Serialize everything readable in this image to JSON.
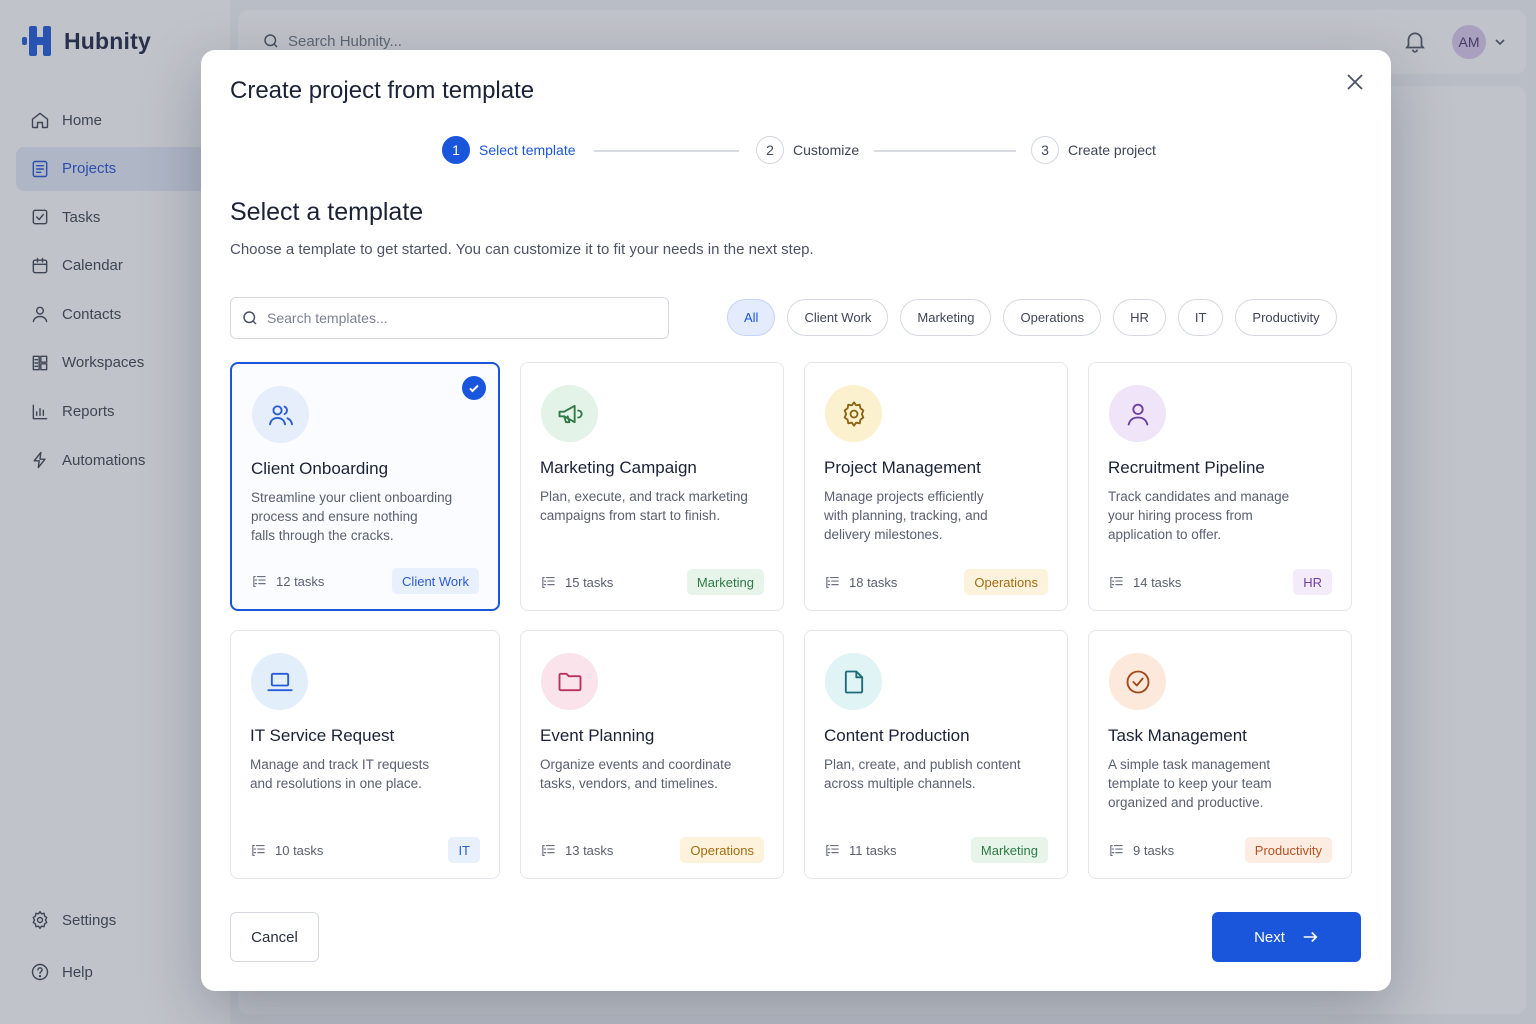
{
  "app": {
    "brand": "Hubnity",
    "search_placeholder": "Search Hubnity...",
    "avatar_initials": "AM",
    "nav": [
      {
        "label": "Home",
        "icon": "home-icon"
      },
      {
        "label": "Projects",
        "icon": "projects-icon",
        "active": true
      },
      {
        "label": "Tasks",
        "icon": "tasks-icon"
      },
      {
        "label": "Calendar",
        "icon": "calendar-icon"
      },
      {
        "label": "Contacts",
        "icon": "contacts-icon"
      },
      {
        "label": "Workspaces",
        "icon": "workspaces-icon"
      },
      {
        "label": "Reports",
        "icon": "reports-icon"
      },
      {
        "label": "Automations",
        "icon": "automations-icon"
      }
    ],
    "nav_bottom": [
      {
        "label": "Settings",
        "icon": "gear-icon"
      },
      {
        "label": "Help",
        "icon": "help-icon"
      }
    ]
  },
  "modal": {
    "title": "Create project from template",
    "steps": [
      {
        "number": "1",
        "label": "Select template",
        "active": true
      },
      {
        "number": "2",
        "label": "Customize"
      },
      {
        "number": "3",
        "label": "Create project"
      }
    ],
    "section_title": "Select a template",
    "section_desc": "Choose a template to get started. You can customize it to fit your needs in the next step.",
    "search_placeholder": "Search templates...",
    "filters": [
      "All",
      "Client Work",
      "Marketing",
      "Operations",
      "HR",
      "IT",
      "Productivity"
    ],
    "active_filter": "All",
    "templates": [
      {
        "title": "Client Onboarding",
        "desc_lines": [
          "Streamline your client onboarding",
          "process and ensure nothing",
          "falls through the cracks."
        ],
        "tasks": "12 tasks",
        "tag": "Client Work",
        "icon": "users-icon",
        "selected": true,
        "icon_bg": "#e6eefc",
        "icon_color": "#2a5bd7",
        "tag_bg": "#e8effd",
        "tag_color": "#2a5bd7"
      },
      {
        "title": "Marketing Campaign",
        "desc_lines": [
          "Plan, execute, and track marketing",
          "campaigns from start to finish."
        ],
        "tasks": "15 tasks",
        "tag": "Marketing",
        "icon": "megaphone-icon",
        "icon_bg": "#e3f3e8",
        "icon_color": "#2f7a46",
        "tag_bg": "#e6f4ea",
        "tag_color": "#2f7a46"
      },
      {
        "title": "Project Management",
        "desc_lines": [
          "Manage projects efficiently",
          "with planning, tracking, and",
          "delivery milestones."
        ],
        "tasks": "18 tasks",
        "tag": "Operations",
        "icon": "gear-icon",
        "icon_bg": "#fcf1cf",
        "icon_color": "#8a6414",
        "tag_bg": "#fdf3dc",
        "tag_color": "#a56b12"
      },
      {
        "title": "Recruitment Pipeline",
        "desc_lines": [
          "Track candidates and manage",
          "your hiring process from",
          "application to offer."
        ],
        "tasks": "14 tasks",
        "tag": "HR",
        "icon": "person-icon",
        "icon_bg": "#efe4f8",
        "icon_color": "#6d3fa4",
        "tag_bg": "#f3ebfa",
        "tag_color": "#6d3fa4"
      },
      {
        "title": "IT Service Request",
        "desc_lines": [
          "Manage and track IT requests",
          "and resolutions in one place."
        ],
        "tasks": "10 tasks",
        "tag": "IT",
        "icon": "laptop-icon",
        "icon_bg": "#e3eefb",
        "icon_color": "#2a5bd7",
        "tag_bg": "#e8effd",
        "tag_color": "#2a5bd7"
      },
      {
        "title": "Event Planning",
        "desc_lines": [
          "Organize events and coordinate",
          "tasks, vendors, and timelines."
        ],
        "tasks": "13 tasks",
        "tag": "Operations",
        "icon": "folder-icon",
        "icon_bg": "#fbe3ec",
        "icon_color": "#b7325f",
        "tag_bg": "#fdf3dc",
        "tag_color": "#a56b12"
      },
      {
        "title": "Content Production",
        "desc_lines": [
          "Plan, create, and publish content",
          "across multiple channels."
        ],
        "tasks": "11 tasks",
        "tag": "Marketing",
        "icon": "document-icon",
        "icon_bg": "#e0f3f5",
        "icon_color": "#1f6b78",
        "tag_bg": "#e6f4ea",
        "tag_color": "#2f7a46"
      },
      {
        "title": "Task Management",
        "desc_lines": [
          "A simple task management",
          "template to keep your team",
          "organized and productive."
        ],
        "tasks": "9 tasks",
        "tag": "Productivity",
        "icon": "check-circle-icon",
        "icon_bg": "#fde8dc",
        "icon_color": "#a34a1c",
        "tag_bg": "#fdece2",
        "tag_color": "#b4531f"
      }
    ],
    "cancel_label": "Cancel",
    "next_label": "Next"
  },
  "colors": {
    "primary": "#1a56db"
  }
}
